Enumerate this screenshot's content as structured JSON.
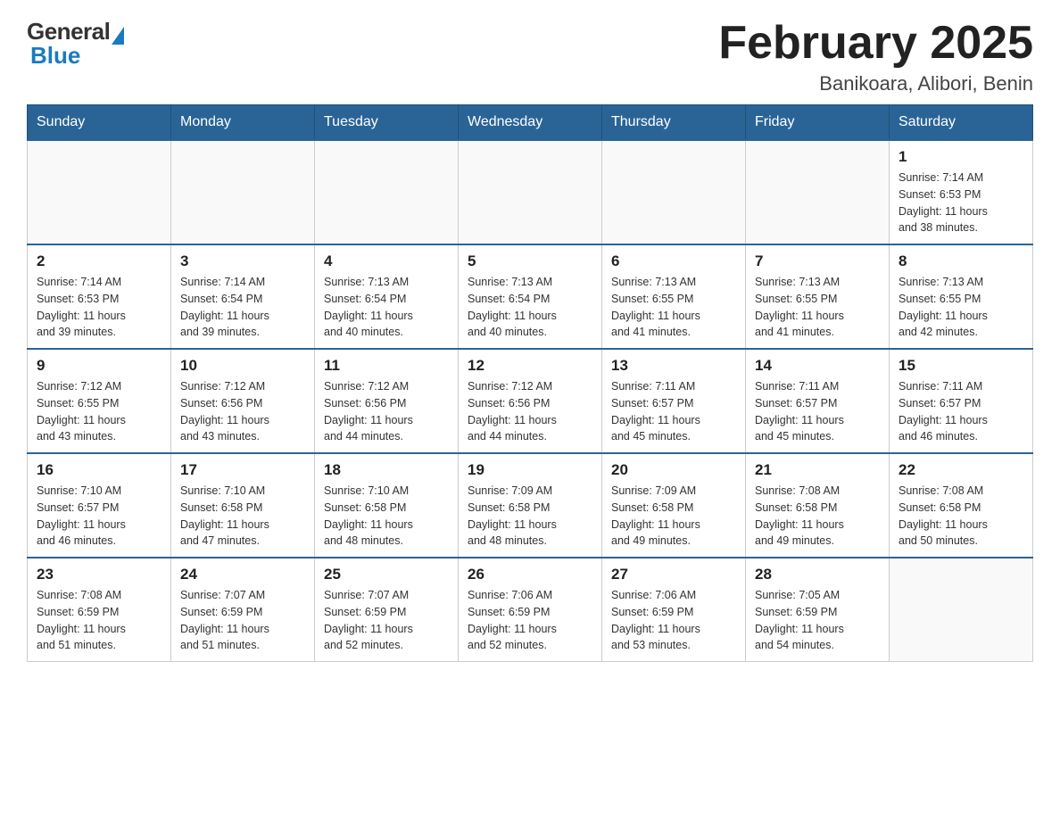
{
  "header": {
    "logo_general": "General",
    "logo_blue": "Blue",
    "month_title": "February 2025",
    "location": "Banikoara, Alibori, Benin"
  },
  "days_of_week": [
    "Sunday",
    "Monday",
    "Tuesday",
    "Wednesday",
    "Thursday",
    "Friday",
    "Saturday"
  ],
  "weeks": [
    [
      {
        "day": "",
        "info": ""
      },
      {
        "day": "",
        "info": ""
      },
      {
        "day": "",
        "info": ""
      },
      {
        "day": "",
        "info": ""
      },
      {
        "day": "",
        "info": ""
      },
      {
        "day": "",
        "info": ""
      },
      {
        "day": "1",
        "info": "Sunrise: 7:14 AM\nSunset: 6:53 PM\nDaylight: 11 hours\nand 38 minutes."
      }
    ],
    [
      {
        "day": "2",
        "info": "Sunrise: 7:14 AM\nSunset: 6:53 PM\nDaylight: 11 hours\nand 39 minutes."
      },
      {
        "day": "3",
        "info": "Sunrise: 7:14 AM\nSunset: 6:54 PM\nDaylight: 11 hours\nand 39 minutes."
      },
      {
        "day": "4",
        "info": "Sunrise: 7:13 AM\nSunset: 6:54 PM\nDaylight: 11 hours\nand 40 minutes."
      },
      {
        "day": "5",
        "info": "Sunrise: 7:13 AM\nSunset: 6:54 PM\nDaylight: 11 hours\nand 40 minutes."
      },
      {
        "day": "6",
        "info": "Sunrise: 7:13 AM\nSunset: 6:55 PM\nDaylight: 11 hours\nand 41 minutes."
      },
      {
        "day": "7",
        "info": "Sunrise: 7:13 AM\nSunset: 6:55 PM\nDaylight: 11 hours\nand 41 minutes."
      },
      {
        "day": "8",
        "info": "Sunrise: 7:13 AM\nSunset: 6:55 PM\nDaylight: 11 hours\nand 42 minutes."
      }
    ],
    [
      {
        "day": "9",
        "info": "Sunrise: 7:12 AM\nSunset: 6:55 PM\nDaylight: 11 hours\nand 43 minutes."
      },
      {
        "day": "10",
        "info": "Sunrise: 7:12 AM\nSunset: 6:56 PM\nDaylight: 11 hours\nand 43 minutes."
      },
      {
        "day": "11",
        "info": "Sunrise: 7:12 AM\nSunset: 6:56 PM\nDaylight: 11 hours\nand 44 minutes."
      },
      {
        "day": "12",
        "info": "Sunrise: 7:12 AM\nSunset: 6:56 PM\nDaylight: 11 hours\nand 44 minutes."
      },
      {
        "day": "13",
        "info": "Sunrise: 7:11 AM\nSunset: 6:57 PM\nDaylight: 11 hours\nand 45 minutes."
      },
      {
        "day": "14",
        "info": "Sunrise: 7:11 AM\nSunset: 6:57 PM\nDaylight: 11 hours\nand 45 minutes."
      },
      {
        "day": "15",
        "info": "Sunrise: 7:11 AM\nSunset: 6:57 PM\nDaylight: 11 hours\nand 46 minutes."
      }
    ],
    [
      {
        "day": "16",
        "info": "Sunrise: 7:10 AM\nSunset: 6:57 PM\nDaylight: 11 hours\nand 46 minutes."
      },
      {
        "day": "17",
        "info": "Sunrise: 7:10 AM\nSunset: 6:58 PM\nDaylight: 11 hours\nand 47 minutes."
      },
      {
        "day": "18",
        "info": "Sunrise: 7:10 AM\nSunset: 6:58 PM\nDaylight: 11 hours\nand 48 minutes."
      },
      {
        "day": "19",
        "info": "Sunrise: 7:09 AM\nSunset: 6:58 PM\nDaylight: 11 hours\nand 48 minutes."
      },
      {
        "day": "20",
        "info": "Sunrise: 7:09 AM\nSunset: 6:58 PM\nDaylight: 11 hours\nand 49 minutes."
      },
      {
        "day": "21",
        "info": "Sunrise: 7:08 AM\nSunset: 6:58 PM\nDaylight: 11 hours\nand 49 minutes."
      },
      {
        "day": "22",
        "info": "Sunrise: 7:08 AM\nSunset: 6:58 PM\nDaylight: 11 hours\nand 50 minutes."
      }
    ],
    [
      {
        "day": "23",
        "info": "Sunrise: 7:08 AM\nSunset: 6:59 PM\nDaylight: 11 hours\nand 51 minutes."
      },
      {
        "day": "24",
        "info": "Sunrise: 7:07 AM\nSunset: 6:59 PM\nDaylight: 11 hours\nand 51 minutes."
      },
      {
        "day": "25",
        "info": "Sunrise: 7:07 AM\nSunset: 6:59 PM\nDaylight: 11 hours\nand 52 minutes."
      },
      {
        "day": "26",
        "info": "Sunrise: 7:06 AM\nSunset: 6:59 PM\nDaylight: 11 hours\nand 52 minutes."
      },
      {
        "day": "27",
        "info": "Sunrise: 7:06 AM\nSunset: 6:59 PM\nDaylight: 11 hours\nand 53 minutes."
      },
      {
        "day": "28",
        "info": "Sunrise: 7:05 AM\nSunset: 6:59 PM\nDaylight: 11 hours\nand 54 minutes."
      },
      {
        "day": "",
        "info": ""
      }
    ]
  ]
}
